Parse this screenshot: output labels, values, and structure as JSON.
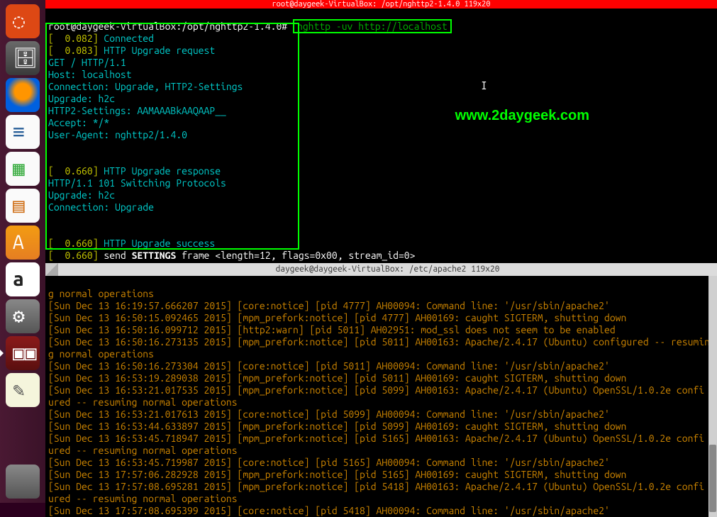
{
  "launcher": {
    "items": [
      {
        "name": "ubuntu-dash",
        "glyph": "◉"
      },
      {
        "name": "files",
        "glyph": "🗄"
      },
      {
        "name": "firefox",
        "glyph": "🦊"
      },
      {
        "name": "libreoffice-writer",
        "glyph": "📄"
      },
      {
        "name": "libreoffice-calc",
        "glyph": "📊"
      },
      {
        "name": "libreoffice-impress",
        "glyph": "📑"
      },
      {
        "name": "software-center",
        "glyph": "🛍"
      },
      {
        "name": "amazon",
        "glyph": "a"
      },
      {
        "name": "settings",
        "glyph": "⚙"
      },
      {
        "name": "terminal",
        "glyph": "▣"
      },
      {
        "name": "text-editor",
        "glyph": "📝"
      },
      {
        "name": "trash",
        "glyph": "🗑"
      }
    ]
  },
  "top_bar_title": "root@daygeek-VirtualBox: /opt/nghttp2-1.4.0 119x20",
  "terminal1": {
    "prompt_user": "root@daygeek-VirtualBox",
    "prompt_path": "/opt/nghttp2-1.4.0",
    "prompt_symbol": "#",
    "command": "nghttp -uv http://localhost",
    "lines": {
      "l1_time": "[  0.082]",
      "l1_text": " Connected",
      "l2_time": "[  0.083]",
      "l2_text": " HTTP Upgrade request",
      "l3": "GET / HTTP/1.1",
      "l4": "Host: localhost",
      "l5": "Connection: Upgrade, HTTP2-Settings",
      "l6": "Upgrade: h2c",
      "l7": "HTTP2-Settings: AAMAAABkAAQAAP__",
      "l8": "Accept: */*",
      "l9": "User-Agent: nghttp2/1.4.0",
      "l10_time": "[  0.660]",
      "l10_text": " HTTP Upgrade response",
      "l11": "HTTP/1.1 101 Switching Protocols",
      "l12": "Upgrade: h2c",
      "l13": "Connection: Upgrade",
      "l14_time": "[  0.660]",
      "l14_text": " HTTP Upgrade success",
      "l15_time": "[  0.660]",
      "l15_a": " send ",
      "l15_b": "SETTINGS",
      "l15_c": " frame <length=12, flags=0x00, stream_id=0>"
    },
    "watermark": "www.2daygeek.com"
  },
  "terminal2": {
    "title": "daygeek@daygeek-VirtualBox: /etc/apache2 119x20",
    "lines": [
      "g normal operations",
      "[Sun Dec 13 16:19:57.666207 2015] [core:notice] [pid 4777] AH00094: Command line: '/usr/sbin/apache2'",
      "[Sun Dec 13 16:50:15.092465 2015] [mpm_prefork:notice] [pid 4777] AH00169: caught SIGTERM, shutting down",
      "[Sun Dec 13 16:50:16.099712 2015] [http2:warn] [pid 5011] AH02951: mod_ssl does not seem to be enabled",
      "[Sun Dec 13 16:50:16.273135 2015] [mpm_prefork:notice] [pid 5011] AH00163: Apache/2.4.17 (Ubuntu) configured -- resumin",
      "g normal operations",
      "[Sun Dec 13 16:50:16.273304 2015] [core:notice] [pid 5011] AH00094: Command line: '/usr/sbin/apache2'",
      "[Sun Dec 13 16:53:19.289038 2015] [mpm_prefork:notice] [pid 5011] AH00169: caught SIGTERM, shutting down",
      "[Sun Dec 13 16:53:21.017535 2015] [mpm_prefork:notice] [pid 5099] AH00163: Apache/2.4.17 (Ubuntu) OpenSSL/1.0.2e confi",
      "ured -- resuming normal operations",
      "[Sun Dec 13 16:53:21.017613 2015] [core:notice] [pid 5099] AH00094: Command line: '/usr/sbin/apache2'",
      "[Sun Dec 13 16:53:44.633897 2015] [mpm_prefork:notice] [pid 5099] AH00169: caught SIGTERM, shutting down",
      "[Sun Dec 13 16:53:45.718947 2015] [mpm_prefork:notice] [pid 5165] AH00163: Apache/2.4.17 (Ubuntu) OpenSSL/1.0.2e confi",
      "ured -- resuming normal operations",
      "[Sun Dec 13 16:53:45.719987 2015] [core:notice] [pid 5165] AH00094: Command line: '/usr/sbin/apache2'",
      "[Sun Dec 13 17:57:06.282928 2015] [mpm_prefork:notice] [pid 5165] AH00169: caught SIGTERM, shutting down",
      "[Sun Dec 13 17:57:08.695281 2015] [mpm_prefork:notice] [pid 5418] AH00163: Apache/2.4.17 (Ubuntu) OpenSSL/1.0.2e confi",
      "ured -- resuming normal operations",
      "[Sun Dec 13 17:57:08.695399 2015] [core:notice] [pid 5418] AH00094: Command line: '/usr/sbin/apache2'"
    ]
  }
}
